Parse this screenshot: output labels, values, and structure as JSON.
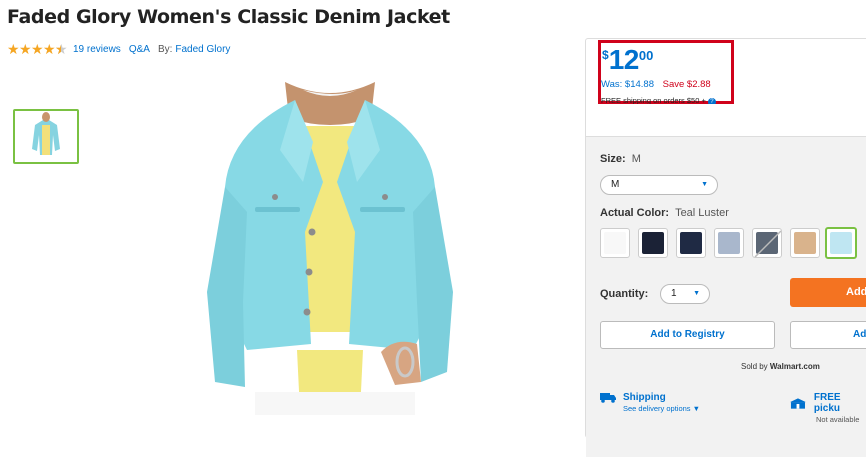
{
  "product": {
    "title": "Faded Glory Women's Classic Denim Jacket",
    "rating": 4.5,
    "reviews_label": "19 reviews",
    "qa_label": "Q&A",
    "by_label": "By:",
    "brand": "Faded Glory"
  },
  "price": {
    "currency": "$",
    "dollars": "12",
    "cents": "00",
    "was": "Was: $14.88",
    "save": "Save $2.88",
    "shipping_note": "FREE shipping on orders $50 +",
    "info_icon": "?"
  },
  "size": {
    "label": "Size:",
    "value": "M",
    "selected": "M"
  },
  "color": {
    "label": "Actual Color:",
    "value": "Teal Luster",
    "swatches": [
      "#f8f8f8",
      "#1b2236",
      "#1f2a44",
      "#a9b7cc",
      "#5b6675",
      "#d9b38c",
      "#bfe6f2"
    ]
  },
  "quantity": {
    "label": "Quantity:",
    "value": "1"
  },
  "actions": {
    "add_to_cart": "Add",
    "add_to_registry": "Add to Registry",
    "add_to_list": "Ad"
  },
  "sold_by": {
    "prefix": "Sold by",
    "seller": "Walmart.com"
  },
  "fulfillment": {
    "shipping_title": "Shipping",
    "shipping_sub": "See delivery options",
    "pickup_title": "FREE picku",
    "pickup_sub": "Not available"
  },
  "colors": {
    "accent": "#0071ce",
    "sale": "#d0021b",
    "orange": "#f47321",
    "selected": "#7ac142"
  }
}
